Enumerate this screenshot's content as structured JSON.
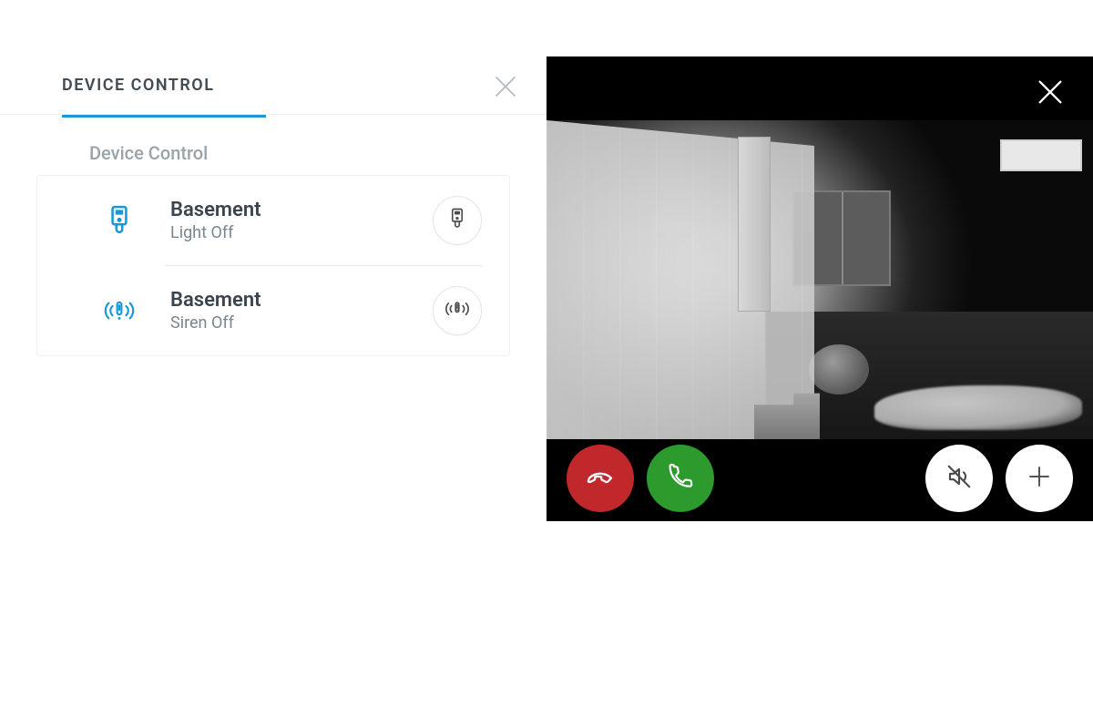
{
  "colors": {
    "accent": "#1998d5",
    "hangup": "#c0282b",
    "answer": "#2d9a2d"
  },
  "header": {
    "tab_title": "DEVICE CONTROL",
    "close_icon": "close-icon"
  },
  "section_label": "Device Control",
  "devices": [
    {
      "icon": "spotlight-cam-icon",
      "name": "Basement",
      "status": "Light Off",
      "action_icon": "light-toggle-icon"
    },
    {
      "icon": "siren-icon",
      "name": "Basement",
      "status": "Siren Off",
      "action_icon": "siren-toggle-icon"
    }
  ],
  "live_view": {
    "close_icon": "close-icon",
    "buttons": {
      "hangup": "end-call-icon",
      "answer": "answer-call-icon",
      "mute": "speaker-mute-icon",
      "more": "plus-icon"
    }
  }
}
